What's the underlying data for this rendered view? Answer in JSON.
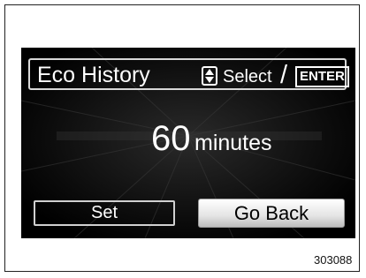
{
  "screen": {
    "title": "Eco History",
    "hint": {
      "icon": "up-down-arrow-icon",
      "select_label": "Select",
      "separator": "/",
      "enter_label": "ENTER"
    },
    "value": "60",
    "unit": "minutes",
    "buttons": {
      "set_label": "Set",
      "go_back_label": "Go Back"
    }
  },
  "figure_code": "303088"
}
